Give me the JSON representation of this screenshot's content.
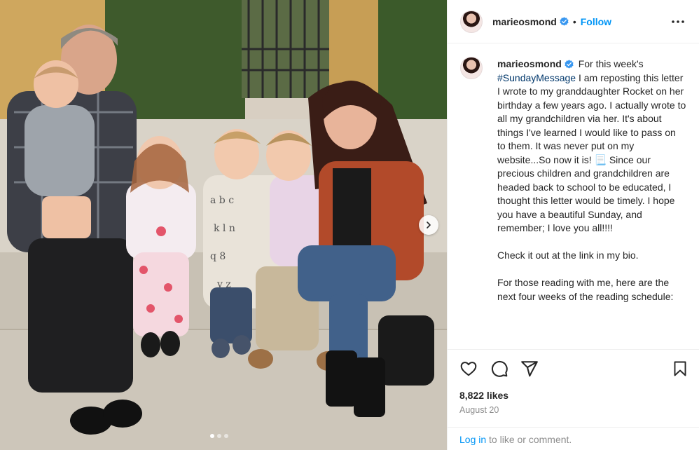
{
  "photo": {
    "carousel_dots": 3,
    "active_dot": 0,
    "next_icon": "chevron-right-icon"
  },
  "header": {
    "username": "marieosmond",
    "separator": "•",
    "follow_label": "Follow",
    "verified_icon": "verified-badge-icon",
    "more_icon": "more-options-icon"
  },
  "caption": {
    "username": "marieosmond",
    "intro": "For this week's",
    "hashtag": "#SundayMessage",
    "body_1": " I am reposting this letter I wrote to my granddaughter Rocket on her birthday a few years ago. I actually wrote to all my grandchildren via her. It's about things I've learned I would like to pass on to them. It was never put on my website...So now it is! 📃 Since our precious children and grandchildren are headed back to school to be educated, I thought this letter would be timely. I hope you have a beautiful Sunday, and remember; I love you all!!!!",
    "body_2": "Check it out at the link in my bio.",
    "body_3": "For those reading with me, here are the next four weeks of the reading schedule:"
  },
  "actions": {
    "like_icon": "heart-icon",
    "comment_icon": "comment-icon",
    "share_icon": "share-icon",
    "save_icon": "bookmark-icon"
  },
  "stats": {
    "likes": "8,822 likes",
    "date": "August 20"
  },
  "footer": {
    "login_label": "Log in",
    "rest": " to like or comment."
  },
  "colors": {
    "accent": "#0095f6",
    "hashtag": "#00376b",
    "muted": "#8e8e8e"
  }
}
